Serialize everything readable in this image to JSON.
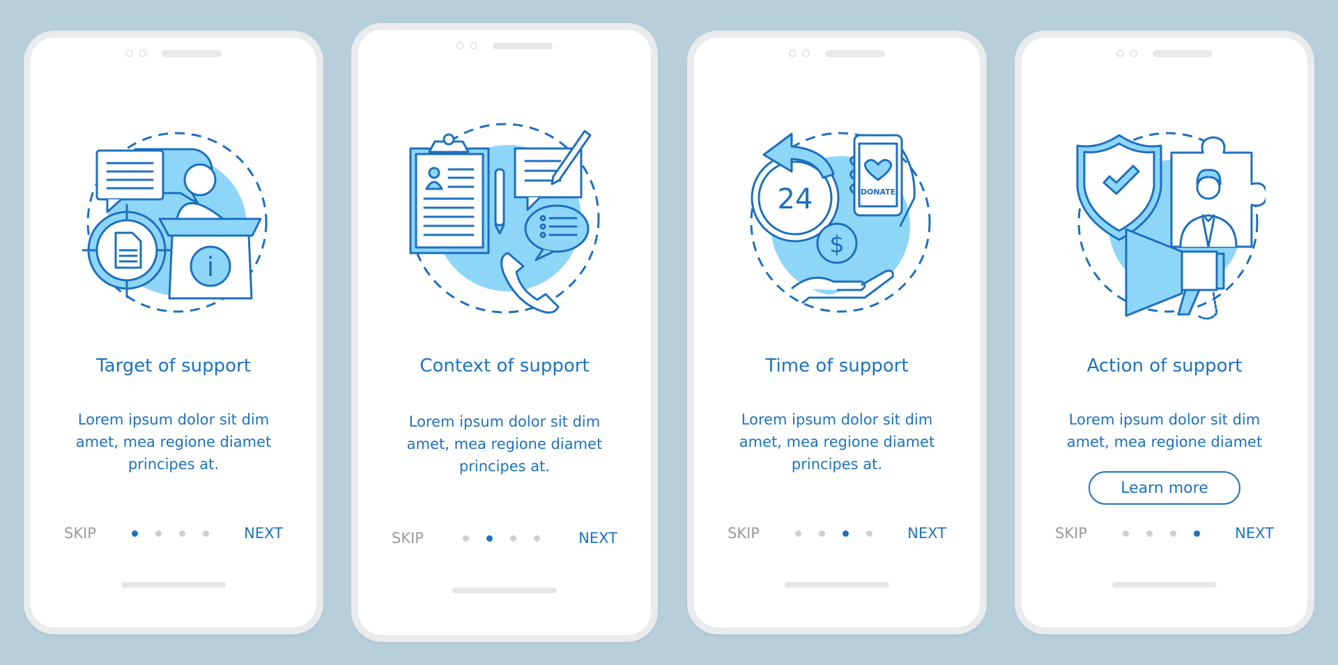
{
  "colors": {
    "background": "#b7cfdb",
    "accent": "#1c72bf",
    "illustration_fill": "#8ed6f8",
    "inactive": "#9a9a9a"
  },
  "screens": [
    {
      "title": "Target of support",
      "body": [
        "Lorem ipsum dolor sit dim",
        "amet, mea regione diamet",
        "principes at."
      ],
      "skip": "SKIP",
      "next": "NEXT",
      "active_page": 1,
      "total_pages": 4,
      "icon": "support-podium-target-icon"
    },
    {
      "title": "Context of support",
      "body": [
        "Lorem ipsum dolor sit dim",
        "amet, mea regione diamet",
        "principes at."
      ],
      "skip": "SKIP",
      "next": "NEXT",
      "active_page": 2,
      "total_pages": 4,
      "icon": "clipboard-chat-phone-icon"
    },
    {
      "title": "Time of support",
      "body": [
        "Lorem ipsum dolor sit dim",
        "amet, mea regione diamet",
        "principes at."
      ],
      "skip": "SKIP",
      "next": "NEXT",
      "active_page": 3,
      "total_pages": 4,
      "icon": "donate-24h-icon",
      "clock_label": "24",
      "donate_label": "DONATE",
      "dollar": "$"
    },
    {
      "title": "Action of support",
      "body": [
        "Lorem ipsum dolor sit dim",
        "amet, mea regione diamet"
      ],
      "button": "Learn more",
      "skip": "SKIP",
      "next": "NEXT",
      "active_page": 4,
      "total_pages": 4,
      "icon": "shield-megaphone-icon"
    }
  ]
}
